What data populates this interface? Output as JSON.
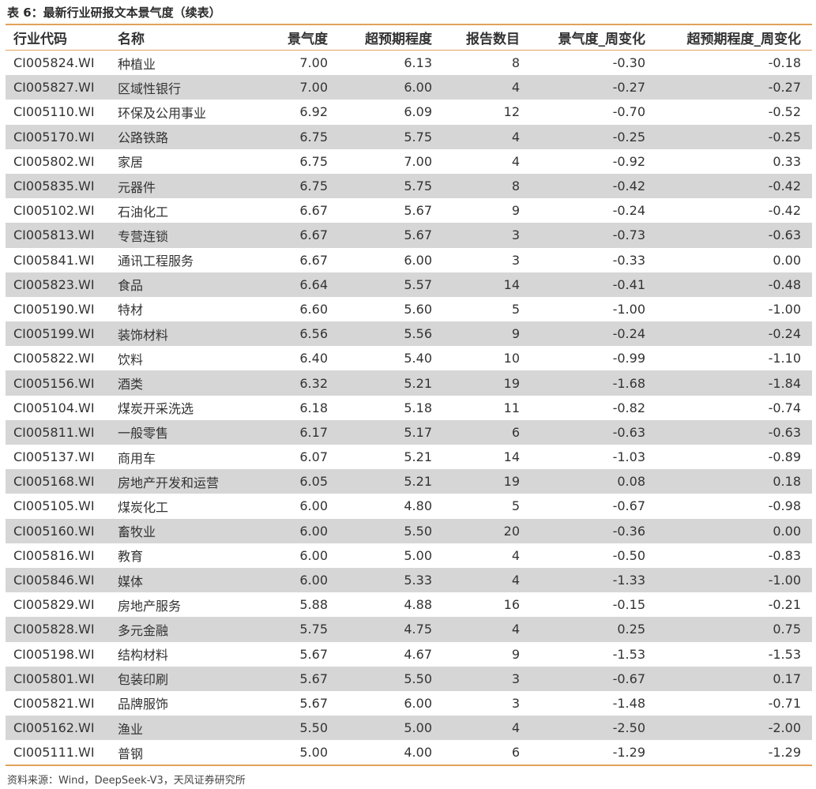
{
  "caption": "表 6：最新行业研报文本景气度（续表）",
  "columns": [
    "行业代码",
    "名称",
    "景气度",
    "超预期程度",
    "报告数目",
    "景气度_周变化",
    "超预期程度_周变化"
  ],
  "rows": [
    [
      "CI005824.WI",
      "种植业",
      "7.00",
      "6.13",
      "8",
      "-0.30",
      "-0.18"
    ],
    [
      "CI005827.WI",
      "区域性银行",
      "7.00",
      "6.00",
      "4",
      "-0.27",
      "-0.27"
    ],
    [
      "CI005110.WI",
      "环保及公用事业",
      "6.92",
      "6.09",
      "12",
      "-0.70",
      "-0.52"
    ],
    [
      "CI005170.WI",
      "公路铁路",
      "6.75",
      "5.75",
      "4",
      "-0.25",
      "-0.25"
    ],
    [
      "CI005802.WI",
      "家居",
      "6.75",
      "7.00",
      "4",
      "-0.92",
      "0.33"
    ],
    [
      "CI005835.WI",
      "元器件",
      "6.75",
      "5.75",
      "8",
      "-0.42",
      "-0.42"
    ],
    [
      "CI005102.WI",
      "石油化工",
      "6.67",
      "5.67",
      "9",
      "-0.24",
      "-0.42"
    ],
    [
      "CI005813.WI",
      "专营连锁",
      "6.67",
      "5.67",
      "3",
      "-0.73",
      "-0.63"
    ],
    [
      "CI005841.WI",
      "通讯工程服务",
      "6.67",
      "6.00",
      "3",
      "-0.33",
      "0.00"
    ],
    [
      "CI005823.WI",
      "食品",
      "6.64",
      "5.57",
      "14",
      "-0.41",
      "-0.48"
    ],
    [
      "CI005190.WI",
      "特材",
      "6.60",
      "5.60",
      "5",
      "-1.00",
      "-1.00"
    ],
    [
      "CI005199.WI",
      "装饰材料",
      "6.56",
      "5.56",
      "9",
      "-0.24",
      "-0.24"
    ],
    [
      "CI005822.WI",
      "饮料",
      "6.40",
      "5.40",
      "10",
      "-0.99",
      "-1.10"
    ],
    [
      "CI005156.WI",
      "酒类",
      "6.32",
      "5.21",
      "19",
      "-1.68",
      "-1.84"
    ],
    [
      "CI005104.WI",
      "煤炭开采洗选",
      "6.18",
      "5.18",
      "11",
      "-0.82",
      "-0.74"
    ],
    [
      "CI005811.WI",
      "一般零售",
      "6.17",
      "5.17",
      "6",
      "-0.63",
      "-0.63"
    ],
    [
      "CI005137.WI",
      "商用车",
      "6.07",
      "5.21",
      "14",
      "-1.03",
      "-0.89"
    ],
    [
      "CI005168.WI",
      "房地产开发和运营",
      "6.05",
      "5.21",
      "19",
      "0.08",
      "0.18"
    ],
    [
      "CI005105.WI",
      "煤炭化工",
      "6.00",
      "4.80",
      "5",
      "-0.67",
      "-0.98"
    ],
    [
      "CI005160.WI",
      "畜牧业",
      "6.00",
      "5.50",
      "20",
      "-0.36",
      "0.00"
    ],
    [
      "CI005816.WI",
      "教育",
      "6.00",
      "5.00",
      "4",
      "-0.50",
      "-0.83"
    ],
    [
      "CI005846.WI",
      "媒体",
      "6.00",
      "5.33",
      "4",
      "-1.33",
      "-1.00"
    ],
    [
      "CI005829.WI",
      "房地产服务",
      "5.88",
      "4.88",
      "16",
      "-0.15",
      "-0.21"
    ],
    [
      "CI005828.WI",
      "多元金融",
      "5.75",
      "4.75",
      "4",
      "0.25",
      "0.75"
    ],
    [
      "CI005198.WI",
      "结构材料",
      "5.67",
      "4.67",
      "9",
      "-1.53",
      "-1.53"
    ],
    [
      "CI005801.WI",
      "包装印刷",
      "5.67",
      "5.50",
      "3",
      "-0.67",
      "0.17"
    ],
    [
      "CI005821.WI",
      "品牌服饰",
      "5.67",
      "6.00",
      "3",
      "-1.48",
      "-0.71"
    ],
    [
      "CI005162.WI",
      "渔业",
      "5.50",
      "5.00",
      "4",
      "-2.50",
      "-2.00"
    ],
    [
      "CI005111.WI",
      "普钢",
      "5.00",
      "4.00",
      "6",
      "-1.29",
      "-1.29"
    ]
  ],
  "source": "资料来源：Wind，DeepSeek-V3，天风证券研究所",
  "colors": {
    "rule": "#e2a25b",
    "stripe": "#d6d6d6",
    "text": "#333333"
  }
}
